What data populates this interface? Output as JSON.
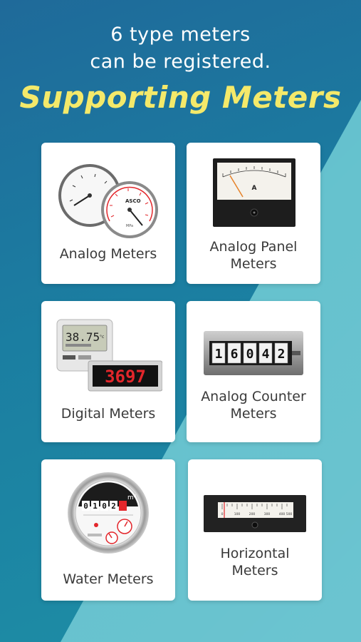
{
  "header": {
    "line1": "6 type meters",
    "line2": "can be registered.",
    "title": "Supporting Meters"
  },
  "cards": [
    {
      "label": "Analog Meters",
      "icon": "pressure-gauge-icon"
    },
    {
      "label_line1": "Analog Panel",
      "label_line2": "Meters",
      "icon": "analog-panel-meter-icon"
    },
    {
      "label": "Digital Meters",
      "icon": "digital-display-icon"
    },
    {
      "label_line1": "Analog Counter",
      "label_line2": "Meters",
      "icon": "mechanical-counter-icon"
    },
    {
      "label": "Water Meters",
      "icon": "water-meter-icon"
    },
    {
      "label_line1": "Horizontal",
      "label_line2": "Meters",
      "icon": "horizontal-meter-icon"
    }
  ],
  "meter_text": {
    "panel_unit": "A",
    "gauge_brand": "ASCO",
    "gauge_unit": "MPa",
    "digital_small": "38.75",
    "digital_small_unit": "°c",
    "digital_big": "3697",
    "counter_digits": [
      "1",
      "6",
      "0",
      "4",
      "2"
    ],
    "water_digits": [
      "0",
      "1",
      "0",
      "2"
    ],
    "water_unit": "m³",
    "horizontal_scale": [
      "0",
      "100",
      "200",
      "300",
      "400",
      "500"
    ]
  },
  "colors": {
    "title_yellow": "#f4e96a",
    "bg_blue": "#1b7ea1",
    "bg_light": "#5fbfcc",
    "red_digit": "#e3262b"
  }
}
